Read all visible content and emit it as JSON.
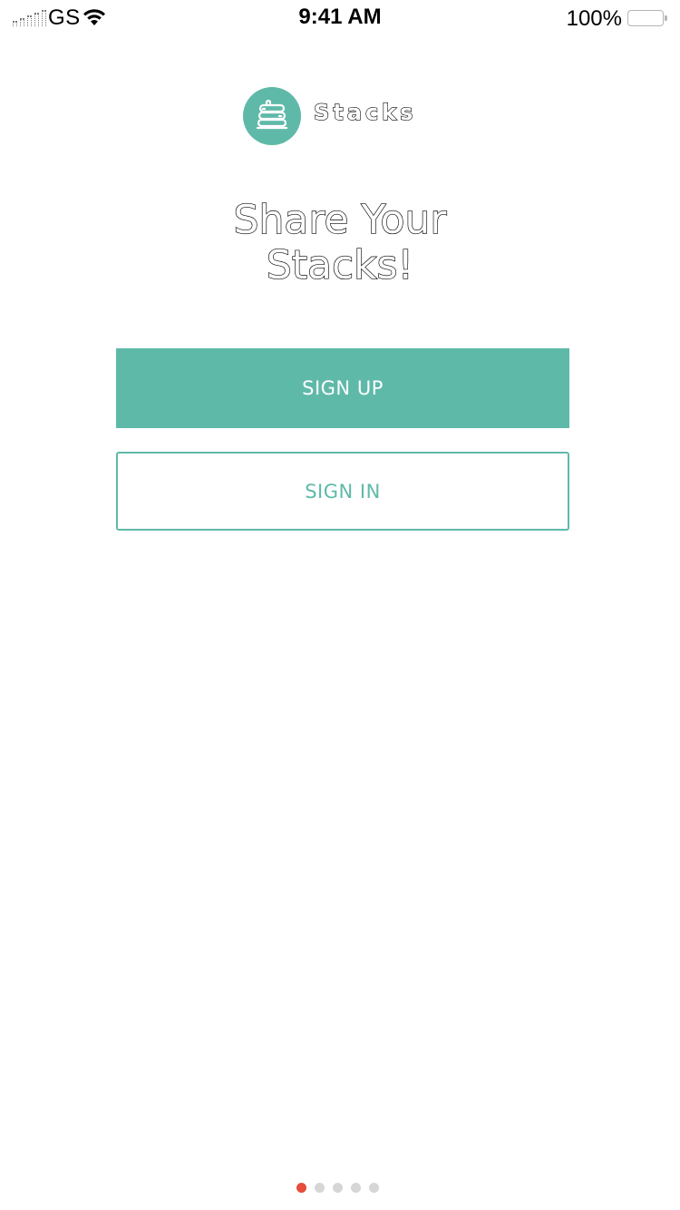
{
  "status_bar": {
    "carrier": "GS",
    "time": "9:41 AM",
    "battery_percent": "100%",
    "icons": [
      "signal-icon",
      "wifi-icon",
      "battery-icon"
    ]
  },
  "brand": {
    "name": "Stacks",
    "logo_icon": "pancake-stack-icon",
    "color": "#5fb9a9"
  },
  "headline": {
    "line1": "Share Your",
    "line2": "Stacks!"
  },
  "buttons": {
    "sign_up": "SIGN UP",
    "sign_in": "SIGN IN"
  },
  "pagination": {
    "total": 5,
    "current": 1,
    "active_color": "#e74c3c",
    "inactive_color": "#d6d6d6"
  }
}
